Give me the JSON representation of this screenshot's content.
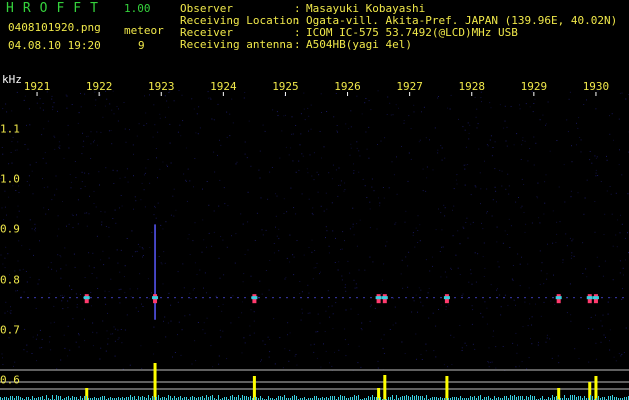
{
  "app": {
    "title": "HROFFT",
    "version": "1.00"
  },
  "file": {
    "name": "0408101920.png",
    "datetime": "04.08.10 19:20"
  },
  "meteor": {
    "label": "meteor",
    "count": "9"
  },
  "info": [
    {
      "key": "Observer",
      "value": "Masayuki Kobayashi"
    },
    {
      "key": "Receiving Location",
      "value": "Ogata-vill. Akita-Pref. JAPAN (139.96E, 40.02N)"
    },
    {
      "key": "Receiver",
      "value": "ICOM IC-575 53.7492(@LCD)MHz USB"
    },
    {
      "key": "Receiving antenna",
      "value": "A504HB(yagi 4el)"
    }
  ],
  "axis": {
    "unit": "kHz",
    "time_ticks": [
      "1921",
      "1922",
      "1923",
      "1924",
      "1925",
      "1926",
      "1927",
      "1928",
      "1929",
      "1930"
    ],
    "freq_ticks": [
      "1.1",
      "1.0",
      "0.9",
      "0.8",
      "0.7",
      "0.6"
    ]
  },
  "colors": {
    "text": "#f0e84a",
    "title": "#35d23c",
    "background": "#000000",
    "noise": "#1a1a66",
    "signal": "#ff3b6e",
    "peak": "#ffff00",
    "cyan": "#39d0e0"
  },
  "meteors": [
    {
      "time": "1921.8"
    },
    {
      "time": "1922.9"
    },
    {
      "time": "1924.5"
    },
    {
      "time": "1926.5"
    },
    {
      "time": "1926.6"
    },
    {
      "time": "1927.6"
    },
    {
      "time": "1929.4"
    },
    {
      "time": "1929.9"
    },
    {
      "time": "1930.0"
    }
  ]
}
